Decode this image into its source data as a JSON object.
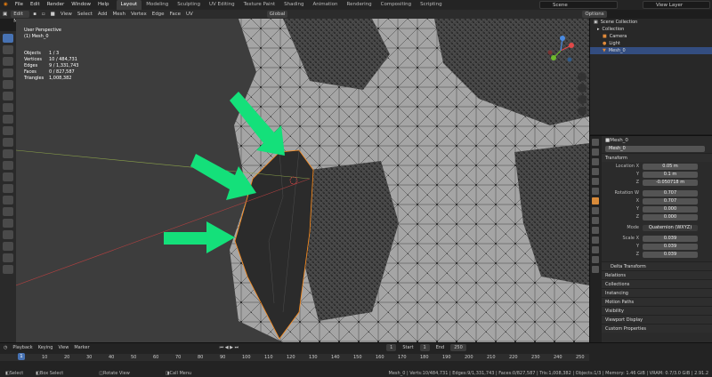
{
  "menu": [
    "File",
    "Edit",
    "Render",
    "Window",
    "Help"
  ],
  "tabs": [
    "Layout",
    "Modeling",
    "Sculpting",
    "UV Editing",
    "Texture Paint",
    "Shading",
    "Animation",
    "Rendering",
    "Compositing",
    "Scripting"
  ],
  "active_tab": "Layout",
  "scene": "Scene",
  "view_layer": "View Layer",
  "header": {
    "mode": "Edit Mode",
    "menus": [
      "View",
      "Select",
      "Add",
      "Mesh",
      "Vertex",
      "Edge",
      "Face",
      "UV"
    ],
    "orientation": "Global",
    "options": "Options"
  },
  "overlay": {
    "line1": "User Perspective",
    "line2": "(1) Mesh_0"
  },
  "stats": [
    {
      "k": "Objects",
      "v": "1 / 3"
    },
    {
      "k": "Vertices",
      "v": "10 / 484,731"
    },
    {
      "k": "Edges",
      "v": "9 / 1,331,743"
    },
    {
      "k": "Faces",
      "v": "0 / 827,587"
    },
    {
      "k": "Triangles",
      "v": "1,008,382"
    }
  ],
  "outliner": {
    "title": "Scene Collection",
    "items": [
      "Collection",
      "Camera",
      "Light",
      "Mesh_0"
    ]
  },
  "properties": {
    "object_name": "Mesh_0",
    "object_field": "Mesh_0",
    "transform_title": "Transform",
    "rows": [
      {
        "label": "Location X",
        "value": "0.05 m"
      },
      {
        "label": "Y",
        "value": "0.1 m"
      },
      {
        "label": "Z",
        "value": "-0.050718 m"
      },
      {
        "label": "Rotation W",
        "value": "0.707"
      },
      {
        "label": "X",
        "value": "0.707"
      },
      {
        "label": "Y",
        "value": "0.000"
      },
      {
        "label": "Z",
        "value": "0.000"
      },
      {
        "label": "Mode",
        "value": "Quaternion (WXYZ)"
      },
      {
        "label": "Scale X",
        "value": "0.039"
      },
      {
        "label": "Y",
        "value": "0.039"
      },
      {
        "label": "Z",
        "value": "0.039"
      }
    ],
    "sections": [
      "Delta Transform",
      "Relations",
      "Collections",
      "Instancing",
      "Motion Paths",
      "Visibility",
      "Viewport Display",
      "Custom Properties"
    ]
  },
  "timeline": {
    "menus": [
      "Playback",
      "Keying",
      "View",
      "Marker"
    ],
    "current": "1",
    "start_label": "Start",
    "start": "1",
    "end_label": "End",
    "end": "250",
    "ticks": [
      "1",
      "10",
      "20",
      "30",
      "40",
      "50",
      "60",
      "70",
      "80",
      "90",
      "100",
      "110",
      "120",
      "130",
      "140",
      "150",
      "160",
      "170",
      "180",
      "190",
      "200",
      "210",
      "220",
      "230",
      "240",
      "250"
    ]
  },
  "status": {
    "select": "Select",
    "box": "Box Select",
    "rotate": "Rotate View",
    "menu": "Call Menu",
    "info": "Mesh_0 | Verts:10/484,731 | Edges:9/1,331,743 | Faces:0/827,587 | Tris:1,008,382 | Objects:1/3 | Memory: 1.46 GiB | VRAM: 0.7/3.0 GiB | 2.91.2"
  }
}
